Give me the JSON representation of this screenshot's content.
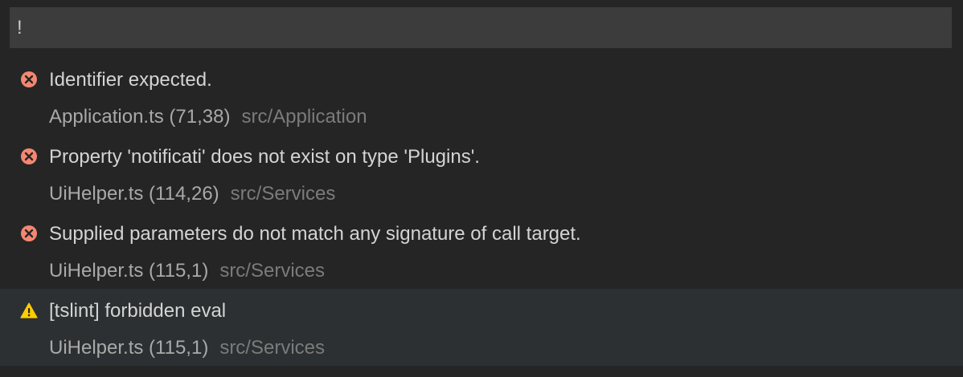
{
  "quick_open": {
    "input_value": "!",
    "items": [
      {
        "severity": "error",
        "icon": "error-icon",
        "message": "Identifier expected.",
        "file": "Application.ts (71,38)",
        "path": "src/Application"
      },
      {
        "severity": "error",
        "icon": "error-icon",
        "message": "Property 'notificati' does not exist on type 'Plugins'.",
        "file": "UiHelper.ts (114,26)",
        "path": "src/Services"
      },
      {
        "severity": "error",
        "icon": "error-icon",
        "message": "Supplied parameters do not match any signature of call target.",
        "file": "UiHelper.ts (115,1)",
        "path": "src/Services"
      },
      {
        "severity": "warning",
        "icon": "warning-icon",
        "message": "[tslint] forbidden eval",
        "file": "UiHelper.ts (115,1)",
        "path": "src/Services",
        "selected": true
      }
    ]
  },
  "colors": {
    "background": "#252526",
    "input_background": "#3c3c3c",
    "selected_background": "#2c3032",
    "error": "#f48771",
    "warning": "#ffcc00"
  }
}
